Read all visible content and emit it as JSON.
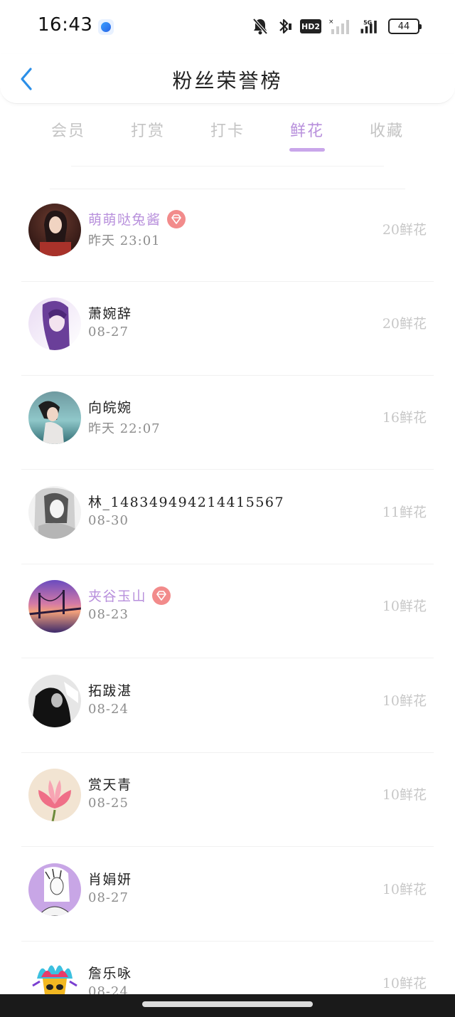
{
  "status_bar": {
    "time": "16:43",
    "network": "HD2",
    "signal_label": "5G",
    "battery": "44"
  },
  "header": {
    "title": "粉丝荣誉榜"
  },
  "tabs": [
    {
      "label": "会员",
      "active": false
    },
    {
      "label": "打赏",
      "active": false
    },
    {
      "label": "打卡",
      "active": false
    },
    {
      "label": "鲜花",
      "active": true
    },
    {
      "label": "收藏",
      "active": false
    }
  ],
  "fans": [
    {
      "name": "萌萌哒兔酱",
      "date": "昨天 23:01",
      "count": "20鲜花",
      "vip": true,
      "avatar": "avatar-girl-red"
    },
    {
      "name": "萧婉辞",
      "date": "08-27",
      "count": "20鲜花",
      "vip": false,
      "avatar": "avatar-anime-purple"
    },
    {
      "name": "向皖婉",
      "date": "昨天 22:07",
      "count": "16鲜花",
      "vip": false,
      "avatar": "avatar-girl-sea"
    },
    {
      "name": "林_148349494214415567",
      "date": "08-30",
      "count": "11鲜花",
      "vip": false,
      "avatar": "avatar-sketch-gray"
    },
    {
      "name": "夹谷玉山",
      "date": "08-23",
      "count": "10鲜花",
      "vip": true,
      "avatar": "avatar-bridge-sunset"
    },
    {
      "name": "拓跋湛",
      "date": "08-24",
      "count": "10鲜花",
      "vip": false,
      "avatar": "avatar-bw-person"
    },
    {
      "name": "赏天青",
      "date": "08-25",
      "count": "10鲜花",
      "vip": false,
      "avatar": "avatar-pink-lotus"
    },
    {
      "name": "肖娟妍",
      "date": "08-27",
      "count": "10鲜花",
      "vip": false,
      "avatar": "avatar-sketch-lilac"
    },
    {
      "name": "詹乐咏",
      "date": "08-24",
      "count": "10鲜花",
      "vip": false,
      "avatar": "avatar-colorful-mask"
    }
  ],
  "colors": {
    "accent": "#b890dc",
    "vip_badge": "#f28b8b",
    "muted": "#c7c7c7"
  }
}
